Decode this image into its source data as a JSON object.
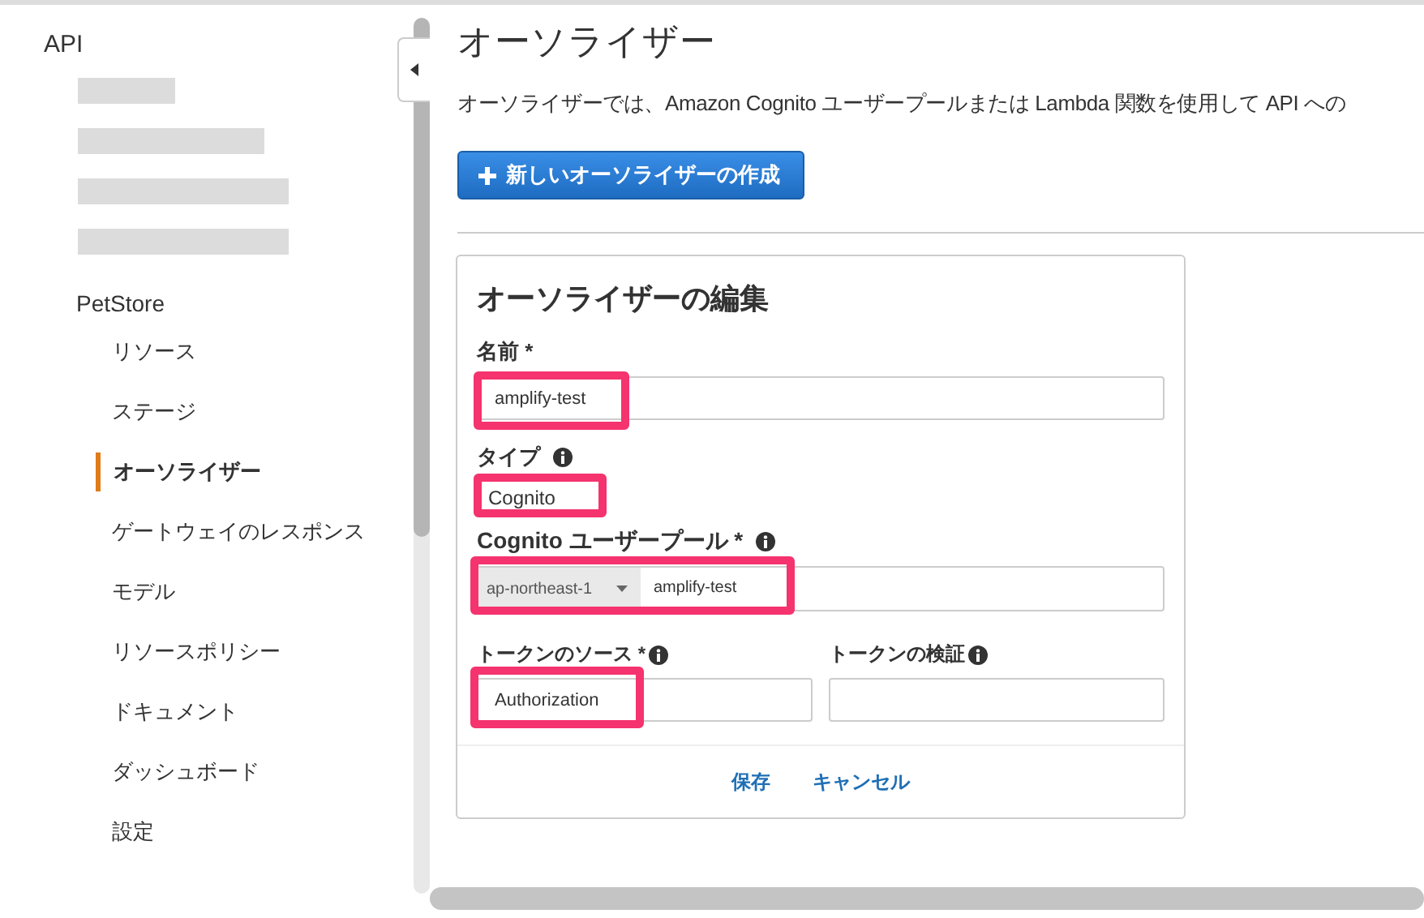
{
  "sidebar": {
    "title": "API",
    "api_name": "PetStore",
    "items": [
      {
        "label": "リソース",
        "selected": false
      },
      {
        "label": "ステージ",
        "selected": false
      },
      {
        "label": "オーソライザー",
        "selected": true
      },
      {
        "label": "ゲートウェイのレスポンス",
        "selected": false
      },
      {
        "label": "モデル",
        "selected": false
      },
      {
        "label": "リソースポリシー",
        "selected": false
      },
      {
        "label": "ドキュメント",
        "selected": false
      },
      {
        "label": "ダッシュボード",
        "selected": false
      },
      {
        "label": "設定",
        "selected": false
      }
    ]
  },
  "page": {
    "title": "オーソライザー",
    "description": "オーソライザーでは、Amazon Cognito ユーザープールまたは Lambda 関数を使用して API への",
    "create_button": "新しいオーソライザーの作成"
  },
  "editor": {
    "title": "オーソライザーの編集",
    "name": {
      "label": "名前 *",
      "value": "amplify-test",
      "highlighted": true
    },
    "type": {
      "label": "タイプ",
      "value": "Cognito",
      "highlighted": true
    },
    "user_pool": {
      "label": "Cognito ユーザープール *",
      "region": "ap-northeast-1",
      "value": "amplify-test",
      "highlighted": true
    },
    "token_source": {
      "label": "トークンのソース *",
      "value": "Authorization",
      "highlighted": true
    },
    "token_validation": {
      "label": "トークンの検証"
    },
    "save": "保存",
    "cancel": "キャンセル"
  }
}
